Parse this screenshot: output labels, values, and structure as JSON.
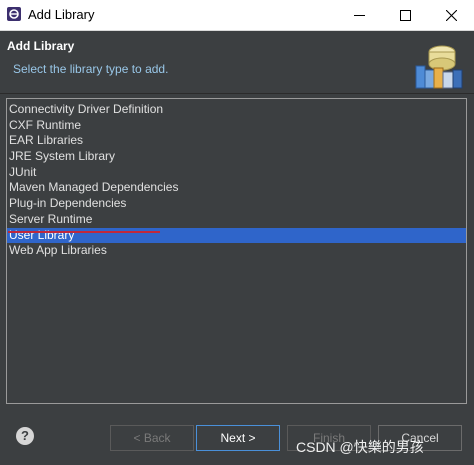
{
  "window": {
    "title": "Add Library",
    "minimize_icon": "minimize-icon",
    "maximize_icon": "maximize-icon",
    "close_icon": "close-icon"
  },
  "header": {
    "title": "Add Library",
    "subtitle": "Select the library type to add.",
    "banner_icon": "library-books-icon"
  },
  "library_types": [
    "Connectivity Driver Definition",
    "CXF Runtime",
    "EAR Libraries",
    "JRE System Library",
    "JUnit",
    "Maven Managed Dependencies",
    "Plug-in Dependencies",
    "Server Runtime",
    "User Library",
    "Web App Libraries"
  ],
  "selected_library": "User Library",
  "buttons": {
    "back": "< Back",
    "next": "Next >",
    "finish": "Finish",
    "cancel": "Cancel"
  },
  "help_icon": "help-icon",
  "watermark": "CSDN @快樂的男孩",
  "colors": {
    "selection": "#2f65ca",
    "annotation_underline": "#c0283b",
    "subtitle": "#99c7e8"
  }
}
